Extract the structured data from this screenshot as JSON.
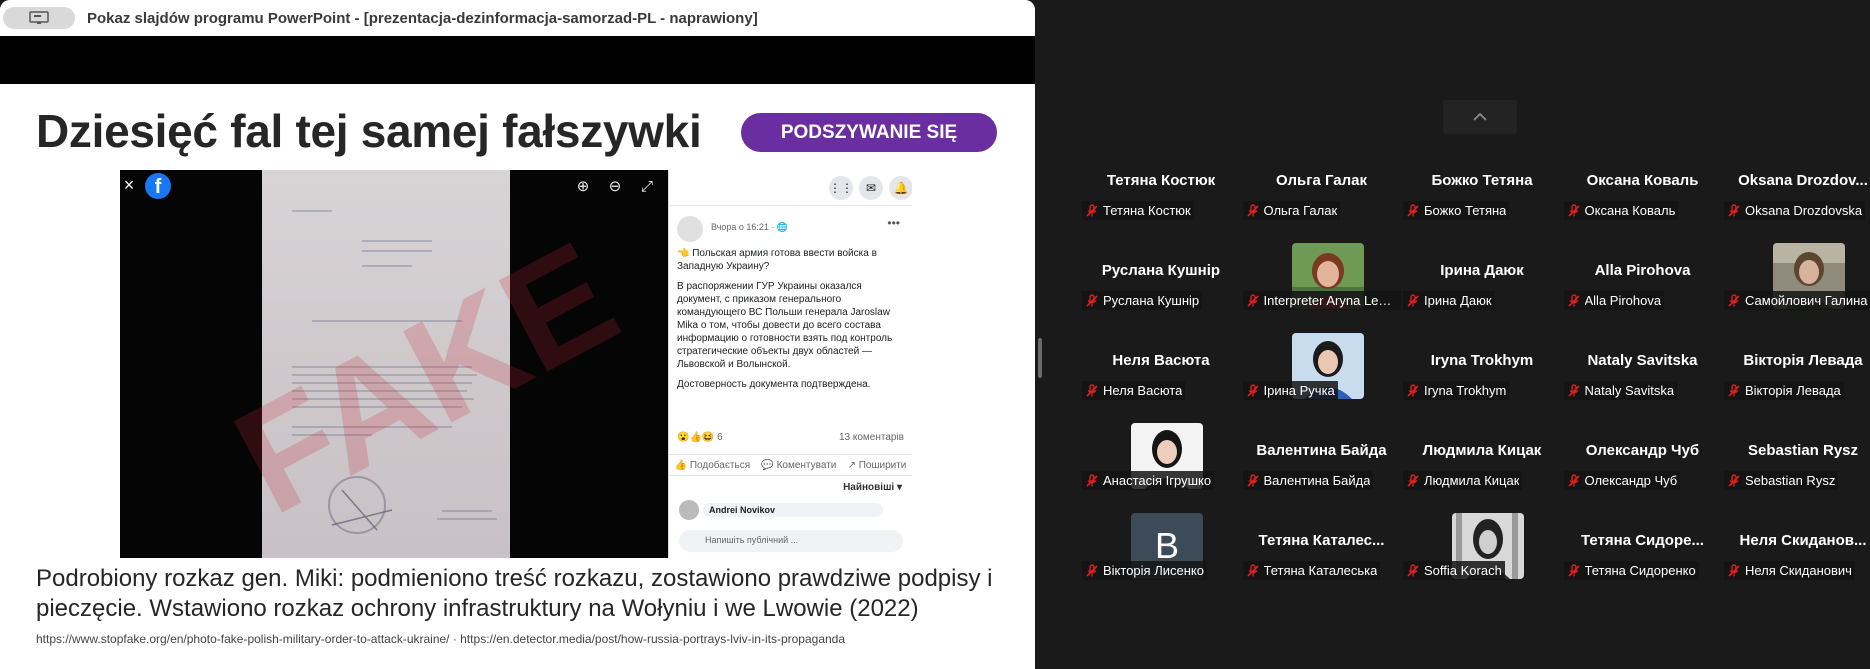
{
  "ppt": {
    "title": "Pokaz slajdów programu PowerPoint - [prezentacja-dezinformacja-samorzad-PL  -  naprawiony]",
    "app_icon": "presentation-icon",
    "slide": {
      "title": "Dziesięć fal tej samej fałszywki",
      "badge": "PODSZYWANIE SIĘ",
      "badge_color": "#6a2ea0",
      "caption": "Podrobiony rozkaz gen. Miki: podmieniono treść rozkazu, zostawiono prawdziwe podpisy i pieczęcie. Wstawiono rozkaz ochrony infrastruktury na Wołyniu i we Lwowie (2022)",
      "sources": "https://www.stopfake.org/en/photo-fake-polish-military-order-to-attack-ukraine/ · https://en.detector.media/post/how-russia-portrays-lviv-in-its-propaganda",
      "fb": {
        "logo": "f",
        "close": "×",
        "zoom_in": "⊕",
        "zoom_out": "⊖",
        "fullscreen": "⤢",
        "watermark": "FAKE",
        "time": "Вчора о 16:21 · 🌐",
        "post_paragraphs": [
          "👈 Польская армия готова ввести войска в Западную Украину?",
          "В распоряжении ГУР Украины оказался документ, с приказом генерального командующего ВС Польши генерала Jaroslaw Mika о том, чтобы довести до всего состава информацию о готовности взять под контроль стратегические объекты двух областей — Львовской и Волынской.",
          "Достоверность документа подтверждена."
        ],
        "reactions": "😮👍😆 6",
        "comments_count": "13 коментарів",
        "actions": [
          "👍 Подобається",
          "💬 Коментувати",
          "↗ Поширити"
        ],
        "sort": "Найновіші ▾",
        "comment_author": "Andrei Novikov",
        "write_placeholder": "Напишіть публічний ..."
      }
    }
  },
  "gallery": {
    "scroll_up": "chevron-up-icon",
    "tiles": [
      {
        "id": "kostiuk",
        "name": "Тетяна Костюк",
        "label": "Тетяна Костюк",
        "avatar": null
      },
      {
        "id": "halak",
        "name": "Ольга Галак",
        "label": "Ольга Галак",
        "avatar": null
      },
      {
        "id": "bozhko",
        "name": "Божко Тетяна",
        "label": "Божко Тетяна",
        "avatar": null
      },
      {
        "id": "koval",
        "name": "Оксана Коваль",
        "label": "Оксана Коваль",
        "avatar": null
      },
      {
        "id": "drozdovska",
        "name": "Oksana  Drozdov...",
        "label": "Oksana Drozdovska",
        "avatar": null
      },
      {
        "id": "kushnir",
        "name": "Руслана Кушнір",
        "label": "Руслана Кушнір",
        "avatar": null
      },
      {
        "id": "lepeti",
        "name": "",
        "label": "Interpreter Aryna Lepeti...",
        "avatar": "photo-woman-red"
      },
      {
        "id": "daiuk",
        "name": "Ірина Даюк",
        "label": "Ірина Даюк",
        "avatar": null
      },
      {
        "id": "pirohova",
        "name": "Alla Pirohova",
        "label": "Alla Pirohova",
        "avatar": null
      },
      {
        "id": "samoilovych",
        "name": "",
        "label": "Самойлович Галина",
        "avatar": "photo-woman-outdoor"
      },
      {
        "id": "vasiuta",
        "name": "Неля Васюта",
        "label": "Неля Васюта",
        "avatar": null
      },
      {
        "id": "ruchka",
        "name": "",
        "label": "Ірина Ручка",
        "avatar": "photo-woman-blue"
      },
      {
        "id": "trokhym",
        "name": "Iryna Trokhym",
        "label": "Iryna Trokhym",
        "avatar": null
      },
      {
        "id": "savitska",
        "name": "Nataly Savitska",
        "label": "Nataly Savitska",
        "avatar": null
      },
      {
        "id": "levada",
        "name": "Вікторія Левада",
        "label": "Вікторія Левада",
        "avatar": null
      },
      {
        "id": "ihrushko",
        "name": "",
        "label": "Анастасія Ігрушко",
        "avatar": "photo-woman-white"
      },
      {
        "id": "baida",
        "name": "Валентина Байда",
        "label": "Валентина Байда",
        "avatar": null
      },
      {
        "id": "kytsak",
        "name": "Людмила Кицак",
        "label": "Людмила Кицак",
        "avatar": null
      },
      {
        "id": "chub",
        "name": "Олександр Чуб",
        "label": "Олександр Чуб",
        "avatar": null
      },
      {
        "id": "rysz",
        "name": "Sebastian Rysz",
        "label": "Sebastian Rysz",
        "avatar": null
      },
      {
        "id": "lysenko",
        "name": "",
        "label": "Вікторія Лисенко",
        "avatar": "letter-B"
      },
      {
        "id": "katalesk",
        "name": "Тетяна  Каталес...",
        "label": "Тетяна Каталеська",
        "avatar": null
      },
      {
        "id": "korach",
        "name": "",
        "label": "Soffia Korach",
        "avatar": "photo-woman-bw"
      },
      {
        "id": "sydorenko",
        "name": "Тетяна  Сидоре...",
        "label": "Тетяна Сидоренко",
        "avatar": null
      },
      {
        "id": "skydanovych",
        "name": "Неля  Скиданов...",
        "label": "Неля Скиданович",
        "avatar": null
      }
    ],
    "avatar_letter": "B",
    "avatar_letter_bg": "#3d4a57",
    "mic_off_color": "#e02020"
  }
}
